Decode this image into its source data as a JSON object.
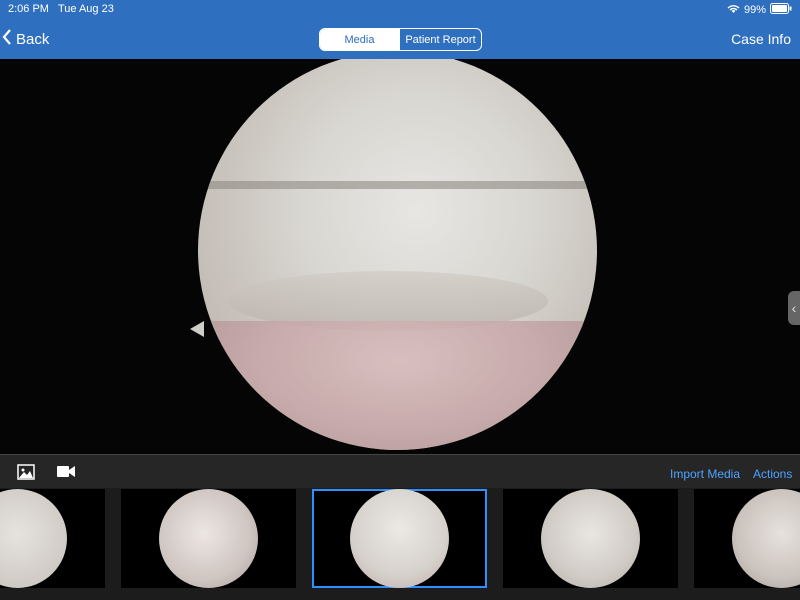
{
  "status": {
    "time": "2:06 PM",
    "date": "Tue Aug 23",
    "battery": "99%"
  },
  "nav": {
    "back_label": "Back",
    "case_info_label": "Case Info",
    "tabs": [
      {
        "label": "Media",
        "active": true
      },
      {
        "label": "Patient Report",
        "active": false
      }
    ]
  },
  "toolbar": {
    "import_label": "Import Media",
    "actions_label": "Actions"
  },
  "colors": {
    "accent": "#2f6fbf",
    "link": "#4da3ff",
    "selected": "#2f8fff"
  },
  "thumbnails": [
    {
      "selected": false
    },
    {
      "selected": false
    },
    {
      "selected": true
    },
    {
      "selected": false
    },
    {
      "selected": false
    }
  ]
}
